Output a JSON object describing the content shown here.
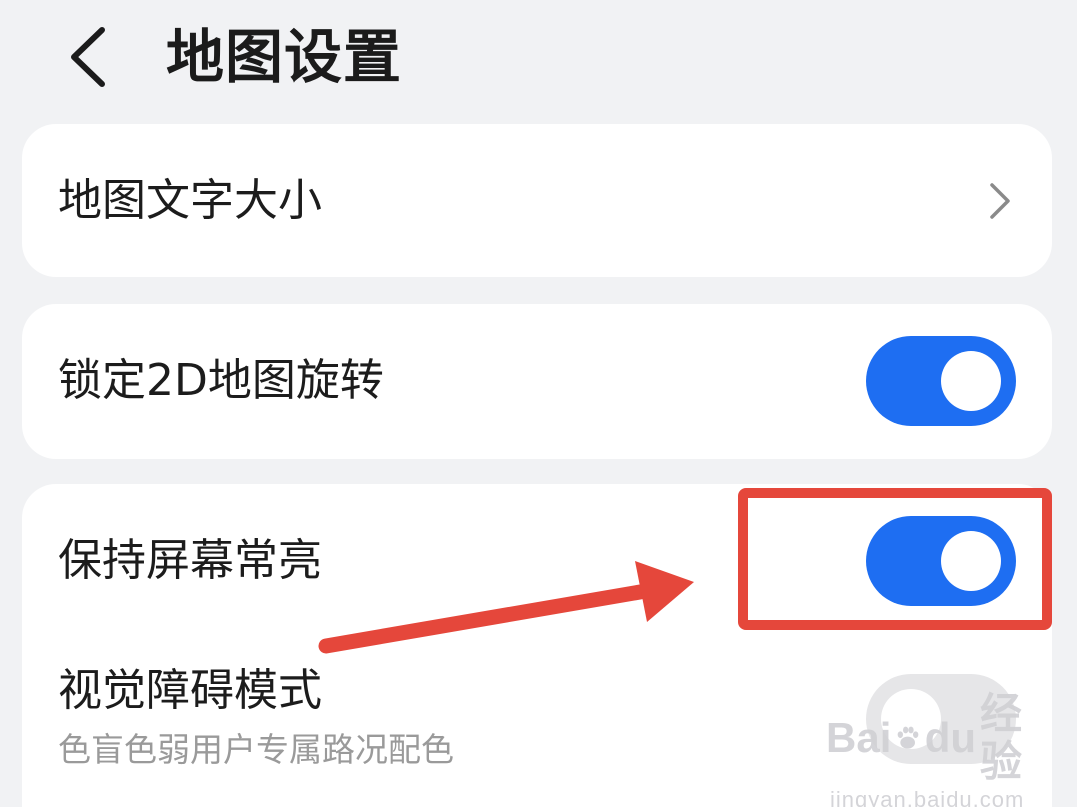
{
  "header": {
    "title": "地图设置"
  },
  "settings": [
    {
      "label": "地图文字大小",
      "control": "chevron"
    },
    {
      "label": "锁定2D地图旋转",
      "control": "switch",
      "on": true
    },
    {
      "label": "保持屏幕常亮",
      "control": "switch",
      "on": true
    },
    {
      "label": "视觉障碍模式",
      "subtitle": "色盲色弱用户专属路况配色",
      "control": "switch",
      "on": false
    }
  ],
  "watermark": {
    "brand_left": "Bai",
    "brand_right": "du",
    "brand_cn": "经验",
    "url": "jingyan.baidu.com"
  },
  "colors": {
    "accent": "#1e6ef2",
    "annotation": "#e5473b",
    "background": "#f1f2f4"
  }
}
